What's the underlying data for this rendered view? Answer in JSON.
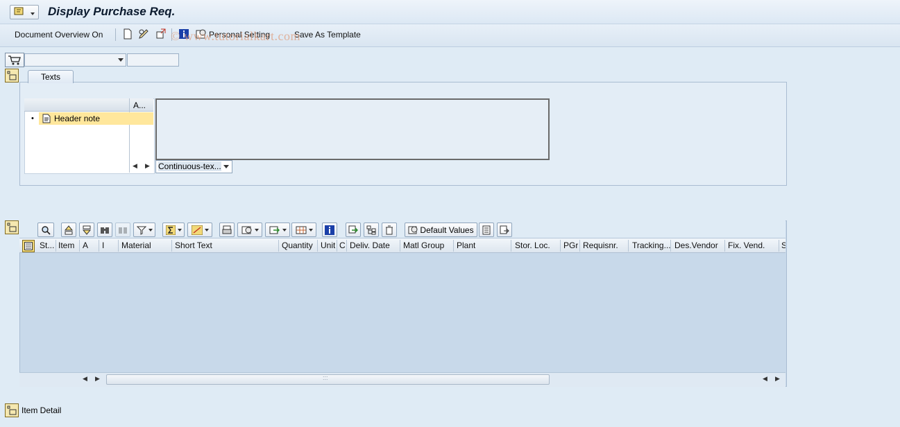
{
  "window": {
    "title": "Display Purchase Req."
  },
  "app_toolbar": {
    "document_overview": "Document Overview On",
    "personal_setting": "Personal Setting",
    "save_as_template": "Save As Template"
  },
  "watermark": "© www.tutorialkart.com",
  "tabs": [
    {
      "label": "Texts"
    }
  ],
  "texts": {
    "column_header": "A...",
    "tree_items": [
      {
        "label": "Header note"
      }
    ],
    "format_select": "Continuous-tex..."
  },
  "grid": {
    "default_values_button": "Default Values",
    "columns": [
      "St...",
      "Item",
      "A",
      "I",
      "Material",
      "Short Text",
      "Quantity",
      "Unit",
      "C",
      "Deliv. Date",
      "Matl Group",
      "Plant",
      "Stor. Loc.",
      "PGr",
      "Requisnr.",
      "Tracking...",
      "Des.Vendor",
      "Fix. Vend.",
      "S"
    ],
    "scroll_grip": ":::"
  },
  "footer": {
    "item_detail": "Item Detail"
  },
  "colors": {
    "background": "#dfebf5",
    "selection": "#ffe79c",
    "grid_body": "#c8d9ea"
  }
}
